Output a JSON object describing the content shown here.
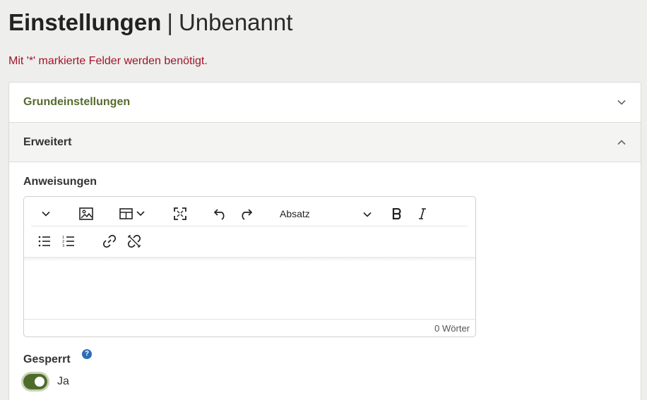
{
  "page": {
    "title_bold": "Einstellungen",
    "separator": "|",
    "title_doc": "Unbenannt"
  },
  "required_note": "Mit '*' markierte Felder werden benötigt.",
  "accordion": {
    "sections": [
      {
        "label": "Grundeinstellungen",
        "expanded": false
      },
      {
        "label": "Erweitert",
        "expanded": true
      }
    ]
  },
  "fields": {
    "instructions": {
      "label": "Anweisungen",
      "format_select": "Absatz",
      "word_count": "0 Wörter",
      "toolbar_row1": [
        "chevron-down-icon",
        "image-icon",
        "table-icon",
        "fullscreen-icon",
        "undo-icon",
        "redo-icon",
        "format-select",
        "bold-icon",
        "italic-icon"
      ],
      "toolbar_row2": [
        "bullet-list-icon",
        "numbered-list-icon",
        "link-icon",
        "unlink-icon"
      ]
    },
    "locked": {
      "label": "Gesperrt",
      "help_glyph": "?",
      "toggle_value": "Ja",
      "toggle_on": true
    }
  },
  "colors": {
    "accent_green": "#4f6b2c",
    "accent_text_green": "#556b2f",
    "required_red": "#a1132a",
    "help_blue": "#2e6db4"
  }
}
